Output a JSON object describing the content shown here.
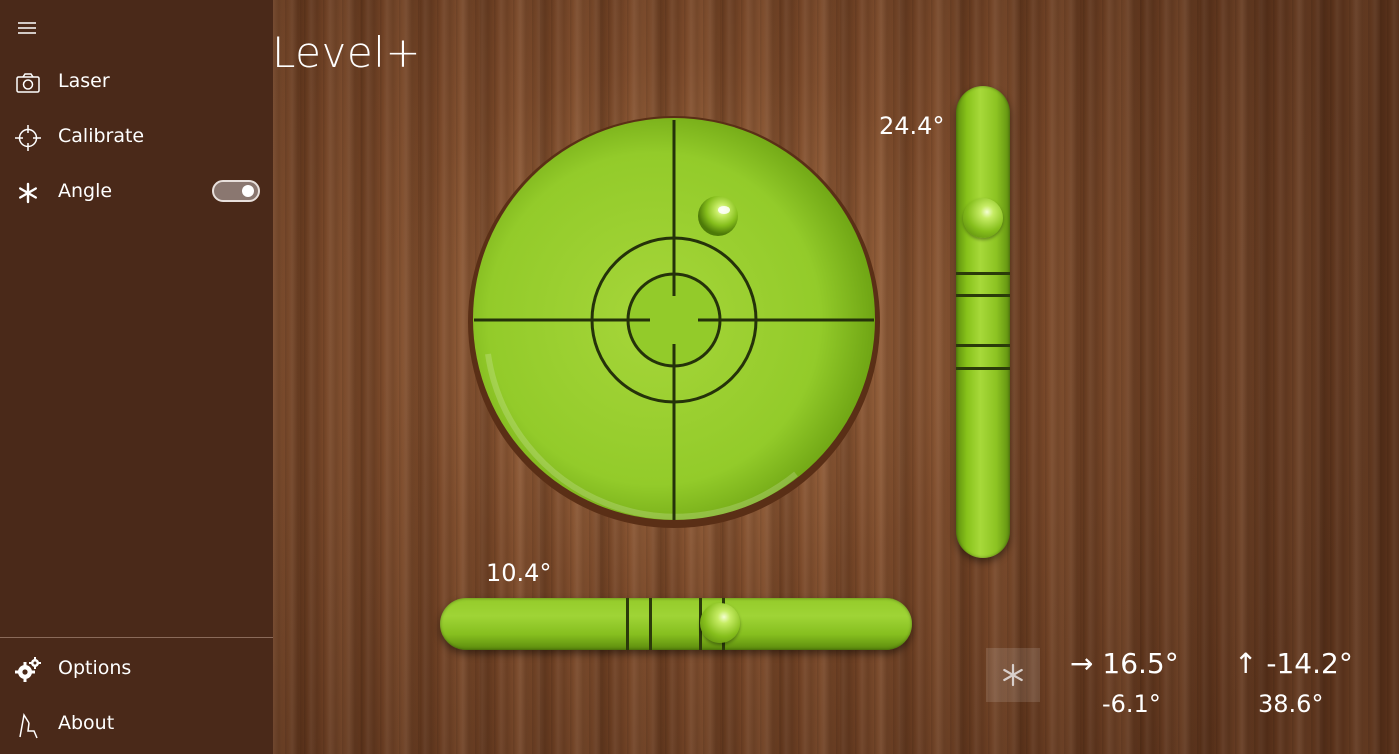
{
  "app": {
    "title": "Level+"
  },
  "sidebar": {
    "menu_icon": "hamburger-icon",
    "items": [
      {
        "label": "Laser",
        "icon": "camera-icon"
      },
      {
        "label": "Calibrate",
        "icon": "crosshair-icon"
      },
      {
        "label": "Angle",
        "icon": "asterisk-icon",
        "toggle_on": true
      }
    ],
    "footer_items": [
      {
        "label": "Options",
        "icon": "gears-icon"
      },
      {
        "label": "About",
        "icon": "about-icon"
      }
    ]
  },
  "levels": {
    "vertical": {
      "angle": "24.4°"
    },
    "horizontal": {
      "angle": "10.4°"
    }
  },
  "readouts": {
    "x": {
      "arrow": "→",
      "main": "16.5°",
      "sub": "-6.1°"
    },
    "y": {
      "arrow": "↑",
      "main": "-14.2°",
      "sub": "38.6°"
    }
  },
  "colors": {
    "sidebar_bg": "#4a2919",
    "level_green": "#8cc322",
    "wood": "#7c4a2a"
  }
}
